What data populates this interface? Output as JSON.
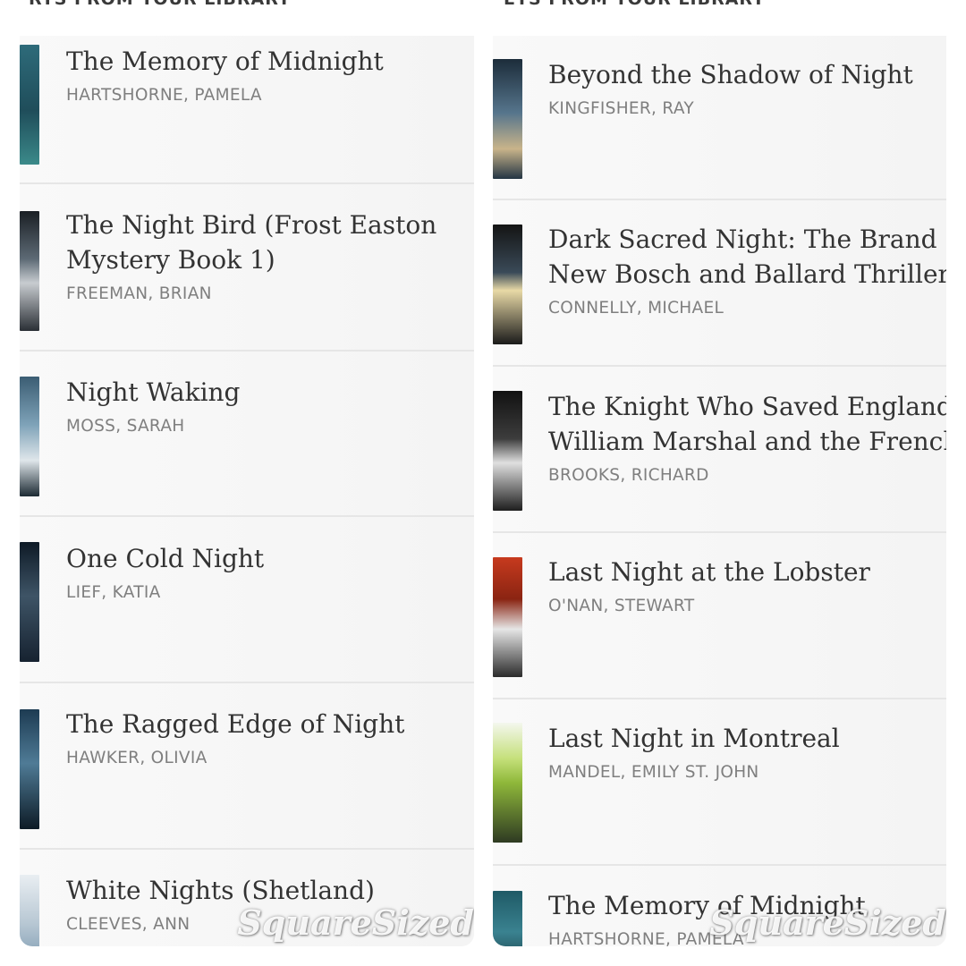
{
  "left_panel": {
    "header": "RTS FROM YOUR LIBRARY",
    "items": [
      {
        "title": "The Memory of Midnight",
        "author": "HARTSHORNE, PAMELA"
      },
      {
        "title": "The Night Bird (Frost Easton",
        "title_line2": "Mystery Book 1)",
        "author": "FREEMAN, BRIAN"
      },
      {
        "title": "Night Waking",
        "author": "MOSS, SARAH"
      },
      {
        "title": "One Cold Night",
        "author": "LIEF, KATIA"
      },
      {
        "title": "The Ragged Edge of Night",
        "author": "HAWKER, OLIVIA"
      },
      {
        "title": "White Nights (Shetland)",
        "author": "CLEEVES, ANN"
      }
    ],
    "watermark": "SquareSized"
  },
  "right_panel": {
    "header": "ETS FROM YOUR LIBRARY",
    "items": [
      {
        "title": "Beyond the Shadow of Night",
        "author": "KINGFISHER, RAY"
      },
      {
        "title": "Dark Sacred Night: The Brand",
        "title_line2": "New Bosch and Ballard Thriller.",
        "author": "CONNELLY, MICHAEL"
      },
      {
        "title": "The Knight Who Saved England",
        "title_line2": "William Marshal and the French",
        "author": "BROOKS, RICHARD"
      },
      {
        "title": "Last Night at the Lobster",
        "author": "O'NAN, STEWART"
      },
      {
        "title": "Last Night in Montreal",
        "author": "MANDEL, EMILY ST. JOHN"
      },
      {
        "title": "The Memory of Midnight",
        "author": "HARTSHORNE, PAMELA"
      }
    ],
    "watermark": "SquareSized"
  },
  "colors": {
    "title": "#333333",
    "author": "#7f7f7f",
    "row_bg": "#f7f7f7",
    "divider": "#e6e6e6"
  },
  "cover_icons": [
    "book-cover-thumbnail"
  ]
}
